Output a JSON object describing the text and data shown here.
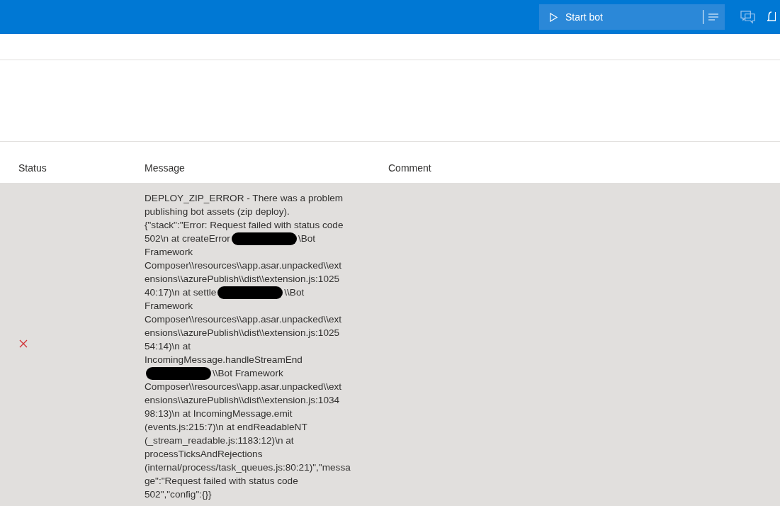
{
  "header": {
    "start_button": {
      "label": "Start bot"
    }
  },
  "table": {
    "columns": [
      "Status",
      "Message",
      "Comment"
    ],
    "rows": [
      {
        "failed": true,
        "message_lines": [
          [
            {
              "text": "DEPLOY_ZIP_ERROR - There was a problem"
            }
          ],
          [
            {
              "text": "publishing bot assets (zip deploy)."
            }
          ],
          [
            {
              "text": "{\"stack\":\"Error: Request failed with status code"
            }
          ],
          [
            {
              "text": "502\\n at createError"
            },
            {
              "kind": "redaction"
            },
            {
              "text": "\\Bot"
            }
          ],
          [
            {
              "text": "Framework"
            }
          ],
          [
            {
              "text": "Composer\\\\resources\\\\app.asar.unpacked\\\\ext"
            }
          ],
          [
            {
              "text": "ensions\\\\azurePublish\\\\dist\\\\extension.js:1025"
            }
          ],
          [
            {
              "text": "40:17)\\n at settle"
            },
            {
              "kind": "redaction"
            },
            {
              "text": "\\\\Bot"
            }
          ],
          [
            {
              "text": "Framework"
            }
          ],
          [
            {
              "text": "Composer\\\\resources\\\\app.asar.unpacked\\\\ext"
            }
          ],
          [
            {
              "text": "ensions\\\\azurePublish\\\\dist\\\\extension.js:1025"
            }
          ],
          [
            {
              "text": "54:14)\\n at"
            }
          ],
          [
            {
              "text": "IncomingMessage.handleStreamEnd"
            }
          ],
          [
            {
              "kind": "redaction"
            },
            {
              "text": "\\\\Bot Framework"
            }
          ],
          [
            {
              "text": "Composer\\\\resources\\\\app.asar.unpacked\\\\ext"
            }
          ],
          [
            {
              "text": "ensions\\\\azurePublish\\\\dist\\\\extension.js:1034"
            }
          ],
          [
            {
              "text": "98:13)\\n at IncomingMessage.emit"
            }
          ],
          [
            {
              "text": "(events.js:215:7)\\n at endReadableNT"
            }
          ],
          [
            {
              "text": "(_stream_readable.js:1183:12)\\n at"
            }
          ],
          [
            {
              "text": "processTicksAndRejections"
            }
          ],
          [
            {
              "text": "(internal/process/task_queues.js:80:21)\",\"messa"
            }
          ],
          [
            {
              "text": "ge\":\"Request failed with status code"
            }
          ],
          [
            {
              "text": "502\",\"config\":{}}"
            }
          ]
        ]
      }
    ]
  }
}
